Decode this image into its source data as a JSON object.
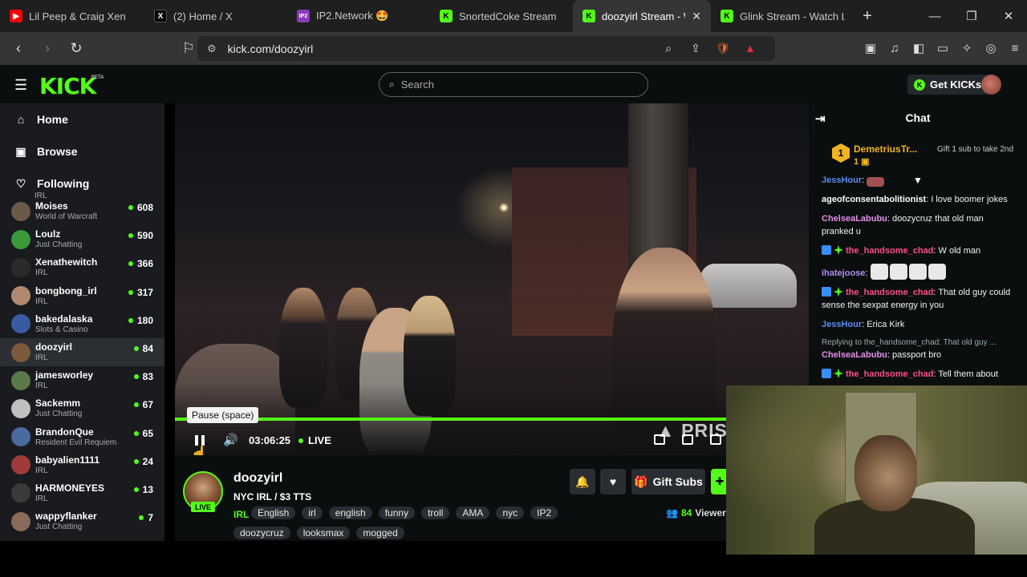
{
  "browser": {
    "tabs": [
      {
        "label": "Lil Peep & Craig Xen",
        "icon_color": "#ff0000",
        "muted": true
      },
      {
        "label": "(2) Home / X",
        "icon_color": "#000000"
      },
      {
        "label": "IP2.Network 🤩",
        "icon_color": "#8a3ab9"
      },
      {
        "label": "SnortedCoke Stream",
        "icon_color": "#53fc18",
        "muted": true
      },
      {
        "label": "doozyirl Stream - W",
        "icon_color": "#53fc18",
        "active": true
      },
      {
        "label": "Glink Stream - Watch Li",
        "icon_color": "#53fc18"
      }
    ],
    "url": "kick.com/doozyirl"
  },
  "kick": {
    "logo": "KICK",
    "beta": "BETA",
    "search_placeholder": "Search",
    "get_kicks": "Get KICKs",
    "accent": "#53fc18"
  },
  "sidebar": {
    "nav": [
      {
        "label": "Home",
        "icon": "home-icon"
      },
      {
        "label": "Browse",
        "icon": "browse-icon"
      },
      {
        "label": "Following",
        "icon": "heart-icon"
      }
    ],
    "top_partial_category": "IRL",
    "channels": [
      {
        "name": "Moises",
        "category": "World of Warcraft",
        "viewers": "608",
        "color": "#6b5a4a"
      },
      {
        "name": "Loulz",
        "category": "Just Chatting",
        "viewers": "590",
        "color": "#3a9a3a"
      },
      {
        "name": "Xenathewitch",
        "category": "IRL",
        "viewers": "366",
        "color": "#2a2a2a"
      },
      {
        "name": "bongbong_irl",
        "category": "IRL",
        "viewers": "317",
        "color": "#b08a70"
      },
      {
        "name": "bakedalaska",
        "category": "Slots & Casino",
        "viewers": "180",
        "color": "#3a5aa0"
      },
      {
        "name": "doozyirl",
        "category": "IRL",
        "viewers": "84",
        "color": "#7a5a3a",
        "selected": true
      },
      {
        "name": "jamesworley",
        "category": "IRL",
        "viewers": "83",
        "color": "#5a7a4a"
      },
      {
        "name": "Sackemm",
        "category": "Just Chatting",
        "viewers": "67",
        "color": "#c0c0c0"
      },
      {
        "name": "BrandonQue",
        "category": "Resident Evil Requiem",
        "viewers": "65",
        "color": "#4a6aa0"
      },
      {
        "name": "babyalien1111",
        "category": "IRL",
        "viewers": "24",
        "color": "#a03a3a"
      },
      {
        "name": "HARMONEYES",
        "category": "IRL",
        "viewers": "13",
        "color": "#3a3a3a"
      },
      {
        "name": "wappyflanker",
        "category": "Just Chatting",
        "viewers": "7",
        "color": "#8a6a5a"
      }
    ]
  },
  "player": {
    "tooltip": "Pause (space)",
    "time": "03:06:25",
    "live": "LIVE",
    "watermark": "PRIS"
  },
  "stream": {
    "name": "doozyirl",
    "title": "NYC IRL / $3 TTS",
    "live_badge": "LIVE",
    "category": "IRL",
    "tags_row1": [
      "English",
      "irl",
      "english",
      "funny",
      "troll",
      "AMA",
      "nyc",
      "IP2"
    ],
    "tags_row2": [
      "doozycruz",
      "looksmax",
      "mogged"
    ],
    "gift_subs": "Gift Subs",
    "viewers": "84",
    "viewers_label": "Viewers"
  },
  "chat": {
    "title": "Chat",
    "pinned": {
      "rank": "1",
      "name": "DemetriusTr...",
      "count": "1",
      "gift_text": "Gift 1 sub to take 2nd"
    },
    "messages": [
      {
        "user": "JessHour",
        "color": "#5b8def",
        "text": "",
        "emote_count": 1,
        "partial_top": true
      },
      {
        "user": "ageofconsentabolitionist",
        "color": "#ffffff",
        "text": "I love boomer jokes"
      },
      {
        "user": "ChelseaLabubu",
        "color": "#e38fe8",
        "text": "doozycruz that old man pranked u"
      },
      {
        "user": "the_handsome_chad",
        "color": "#ff4d8a",
        "text": "W old man",
        "badges": true
      },
      {
        "user": "ihatejoose",
        "color": "#b28cf5",
        "text": "",
        "emote_count": 4
      },
      {
        "user": "the_handsome_chad",
        "color": "#ff4d8a",
        "text": "That old guy could sense the sexpat energy in you",
        "badges": true
      },
      {
        "user": "JessHour",
        "color": "#5b8def",
        "text": "Erica Kirk"
      },
      {
        "reply": "Replying to the_handsome_chad: That old guy ...",
        "user": "ChelseaLabubu",
        "color": "#e38fe8",
        "text": "passport bro"
      },
      {
        "user": "the_handsome_chad",
        "color": "#ff4d8a",
        "text": "Tell them about",
        "badges": true
      }
    ]
  }
}
